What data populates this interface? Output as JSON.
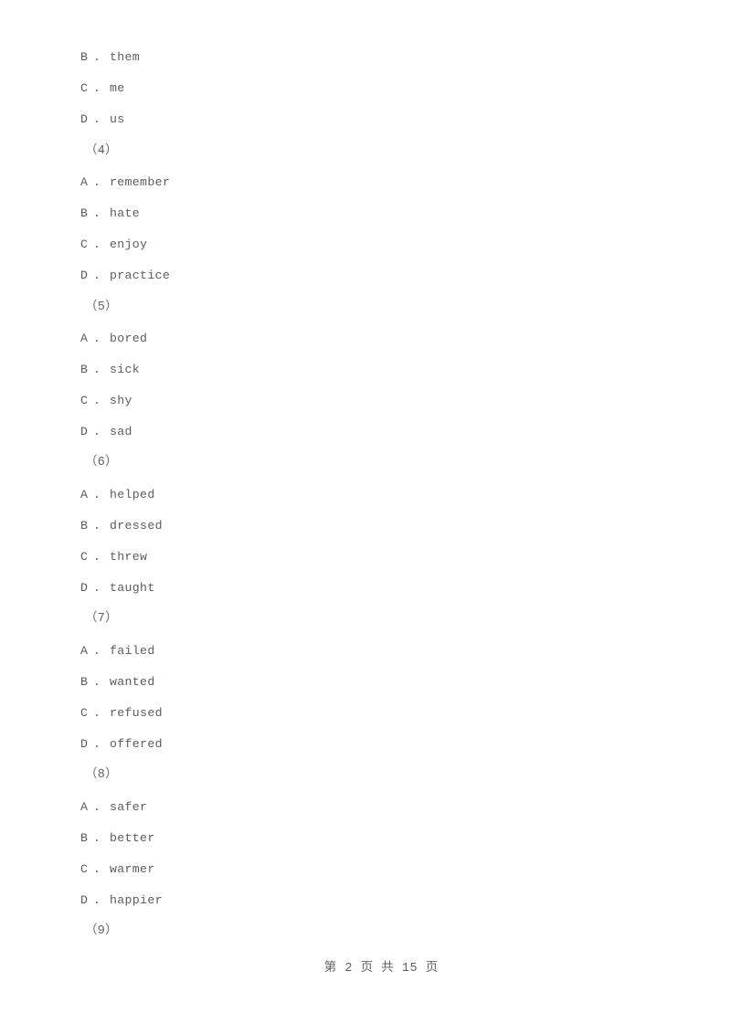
{
  "document": {
    "background_color": "#ffffff",
    "text_color": "#5c5c5c"
  },
  "content": {
    "lines": [
      {
        "kind": "option",
        "letter": "B",
        "dot": ".",
        "text": "them"
      },
      {
        "kind": "option",
        "letter": "C",
        "dot": ".",
        "text": "me"
      },
      {
        "kind": "option",
        "letter": "D",
        "dot": ".",
        "text": "us"
      },
      {
        "kind": "question_number",
        "text": "（4）"
      },
      {
        "kind": "option",
        "letter": "A",
        "dot": ".",
        "text": "remember"
      },
      {
        "kind": "option",
        "letter": "B",
        "dot": ".",
        "text": "hate"
      },
      {
        "kind": "option",
        "letter": "C",
        "dot": ".",
        "text": "enjoy"
      },
      {
        "kind": "option",
        "letter": "D",
        "dot": ".",
        "text": "practice"
      },
      {
        "kind": "question_number",
        "text": "（5）"
      },
      {
        "kind": "option",
        "letter": "A",
        "dot": ".",
        "text": "bored"
      },
      {
        "kind": "option",
        "letter": "B",
        "dot": ".",
        "text": "sick"
      },
      {
        "kind": "option",
        "letter": "C",
        "dot": ".",
        "text": "shy"
      },
      {
        "kind": "option",
        "letter": "D",
        "dot": ".",
        "text": "sad"
      },
      {
        "kind": "question_number",
        "text": "（6）"
      },
      {
        "kind": "option",
        "letter": "A",
        "dot": ".",
        "text": "helped"
      },
      {
        "kind": "option",
        "letter": "B",
        "dot": ".",
        "text": "dressed"
      },
      {
        "kind": "option",
        "letter": "C",
        "dot": ".",
        "text": "threw"
      },
      {
        "kind": "option",
        "letter": "D",
        "dot": ".",
        "text": "taught"
      },
      {
        "kind": "question_number",
        "text": "（7）"
      },
      {
        "kind": "option",
        "letter": "A",
        "dot": ".",
        "text": "failed"
      },
      {
        "kind": "option",
        "letter": "B",
        "dot": ".",
        "text": "wanted"
      },
      {
        "kind": "option",
        "letter": "C",
        "dot": ".",
        "text": "refused"
      },
      {
        "kind": "option",
        "letter": "D",
        "dot": ".",
        "text": "offered"
      },
      {
        "kind": "question_number",
        "text": "（8）"
      },
      {
        "kind": "option",
        "letter": "A",
        "dot": ".",
        "text": "safer"
      },
      {
        "kind": "option",
        "letter": "B",
        "dot": ".",
        "text": "better"
      },
      {
        "kind": "option",
        "letter": "C",
        "dot": ".",
        "text": "warmer"
      },
      {
        "kind": "option",
        "letter": "D",
        "dot": ".",
        "text": "happier"
      },
      {
        "kind": "question_number",
        "text": "（9）"
      }
    ]
  },
  "footer": {
    "page_label": "第 2 页 共 15 页",
    "current_page": "2",
    "total_pages": "15"
  }
}
